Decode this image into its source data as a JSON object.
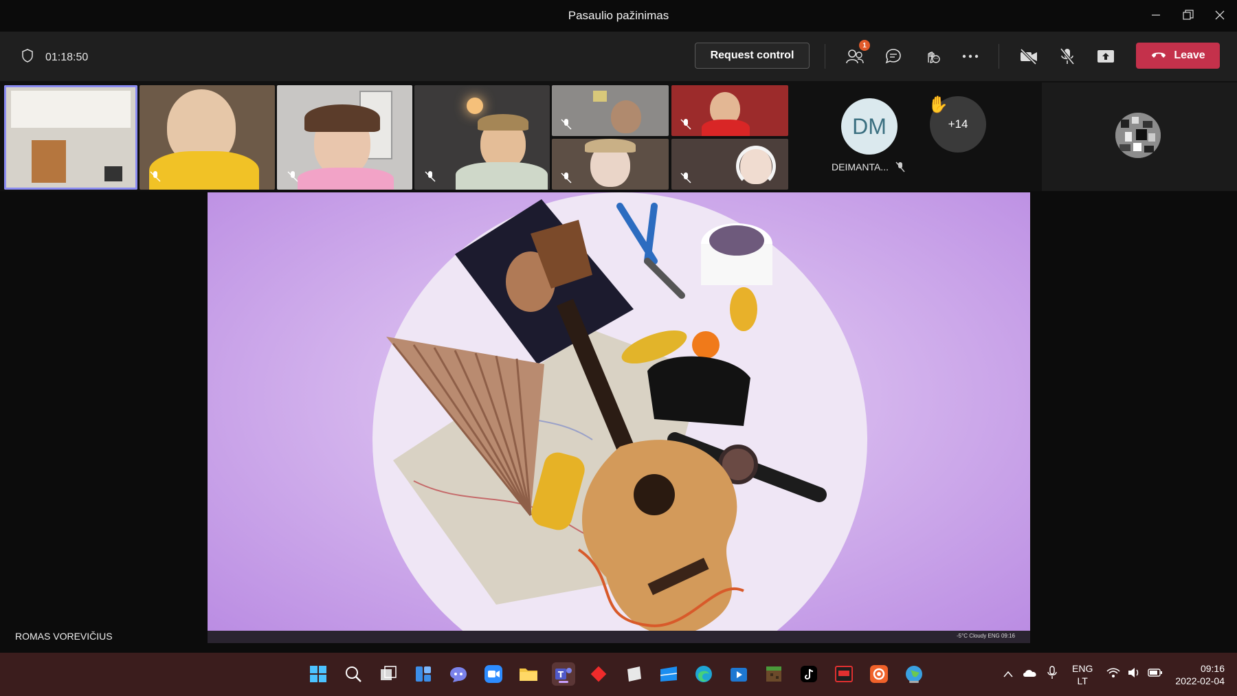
{
  "window": {
    "title": "Pasaulio pažinimas"
  },
  "toolbar": {
    "timer": "01:18:50",
    "request_control_label": "Request control",
    "participants_badge": "1",
    "leave_label": "Leave"
  },
  "gallery": {
    "named_participant_initials": "DM",
    "named_participant_name": "DEIMANTA...",
    "overflow_count": "+14"
  },
  "stage": {
    "presenter_name": "ROMAS VOREVIČIUS",
    "shared_taskbar_text": "-5°C Cloudy  ENG 09:16"
  },
  "taskbar": {
    "language_line1": "ENG",
    "language_line2": "LT",
    "time": "09:16",
    "date": "2022-02-04"
  },
  "colors": {
    "leave_red": "#c4314b",
    "selected_tile_outline": "#8b8cf2",
    "taskbar_bg": "#3b1d1d"
  }
}
